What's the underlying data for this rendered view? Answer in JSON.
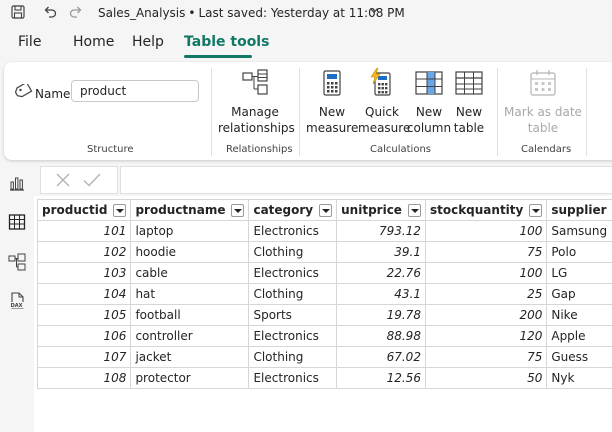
{
  "titlebar": {
    "file_name": "Sales_Analysis",
    "separator": "•",
    "last_saved": "Last saved: Yesterday at 11:08 PM"
  },
  "menu": {
    "tabs": [
      {
        "label": "File"
      },
      {
        "label": "Home"
      },
      {
        "label": "Help"
      },
      {
        "label": "Table tools"
      }
    ],
    "active_tab": "Table tools",
    "accent_color": "#117865"
  },
  "ribbon": {
    "structure": {
      "name_label": "Name",
      "name_value": "product",
      "group_label": "Structure"
    },
    "relationships": {
      "manage_label": "Manage\nrelationships",
      "group_label": "Relationships"
    },
    "calculations": {
      "new_measure_label": "New\nmeasure",
      "quick_measure_label": "Quick\nmeasure",
      "new_column_label": "New\ncolumn",
      "new_table_label": "New\ntable",
      "group_label": "Calculations"
    },
    "calendars": {
      "mark_as_date_label": "Mark as date\ntable",
      "group_label": "Calendars"
    }
  },
  "left_rail": {
    "icons": [
      "report-view-icon",
      "table-view-icon",
      "model-view-icon",
      "dax-query-icon"
    ]
  },
  "table": {
    "columns": [
      "productid",
      "productname",
      "category",
      "unitprice",
      "stockquantity",
      "supplier"
    ],
    "rows": [
      [
        "101",
        "laptop",
        "Electronics",
        "793.12",
        "100",
        "Samsung"
      ],
      [
        "102",
        "hoodie",
        "Clothing",
        "39.1",
        "75",
        "Polo"
      ],
      [
        "103",
        "cable",
        "Electronics",
        "22.76",
        "100",
        "LG"
      ],
      [
        "104",
        "hat",
        "Clothing",
        "43.1",
        "25",
        "Gap"
      ],
      [
        "105",
        "football",
        "Sports",
        "19.78",
        "200",
        "Nike"
      ],
      [
        "106",
        "controller",
        "Electronics",
        "88.98",
        "120",
        "Apple"
      ],
      [
        "107",
        "jacket",
        "Clothing",
        "67.02",
        "75",
        "Guess"
      ],
      [
        "108",
        "protector",
        "Electronics",
        "12.56",
        "50",
        "Nyk"
      ]
    ],
    "numeric_columns": [
      0,
      3,
      4
    ]
  }
}
